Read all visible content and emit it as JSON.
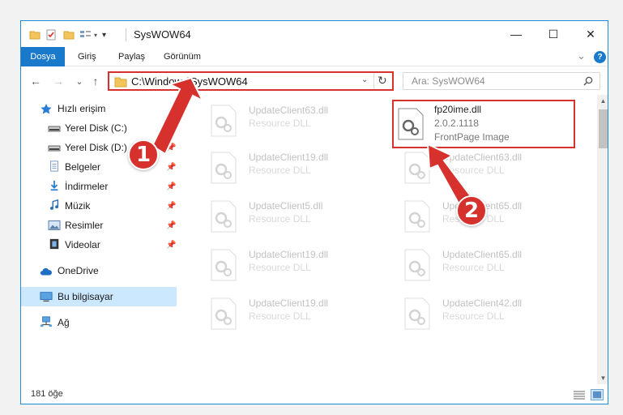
{
  "window": {
    "title": "SysWOW64",
    "minimize": "—",
    "maximize": "☐",
    "close": "✕"
  },
  "ribbon": {
    "tabs": [
      "Dosya",
      "Giriş",
      "Paylaş",
      "Görünüm"
    ],
    "collapse": "⌄",
    "help": "?"
  },
  "nav": {
    "back": "←",
    "forward": "→",
    "recent": "⌄",
    "up": "↑",
    "address": "C:\\Windows\\SysWOW64",
    "refresh": "↻",
    "search_placeholder": "Ara: SysWOW64",
    "search_icon": "search-icon"
  },
  "sidebar": {
    "quick_access": "Hızlı erişim",
    "items": [
      {
        "label": "Yerel Disk (C:)",
        "icon": "drive-icon"
      },
      {
        "label": "Yerel Disk (D:)",
        "icon": "drive-icon"
      },
      {
        "label": "Belgeler",
        "icon": "documents-icon"
      },
      {
        "label": "İndirmeler",
        "icon": "downloads-icon"
      },
      {
        "label": "Müzik",
        "icon": "music-icon"
      },
      {
        "label": "Resimler",
        "icon": "pictures-icon"
      },
      {
        "label": "Videolar",
        "icon": "videos-icon"
      }
    ],
    "onedrive": "OneDrive",
    "this_pc": "Bu bilgisayar",
    "network": "Ağ",
    "pin": "📌"
  },
  "files": {
    "left_column": [
      {
        "name": "UpdateClient63.dll",
        "desc": "Resource DLL"
      },
      {
        "name": "UpdateClient19.dll",
        "desc": "Resource DLL"
      },
      {
        "name": "UpdateClient5.dll",
        "desc": "Resource DLL"
      },
      {
        "name": "UpdateClient19.dll",
        "desc": "Resource DLL"
      },
      {
        "name": "UpdateClient19.dll",
        "desc": "Resource DLL"
      }
    ],
    "right_column": [
      {
        "name": "fp20ime.dll",
        "desc": "2.0.2.1118",
        "extra": "FrontPage Image"
      },
      {
        "name": "UpdateClient63.dll",
        "desc": "Resource DLL"
      },
      {
        "name": "UpdateClient65.dll",
        "desc": "Resource DLL"
      },
      {
        "name": "UpdateClient65.dll",
        "desc": "Resource DLL"
      },
      {
        "name": "UpdateClient42.dll",
        "desc": "Resource DLL"
      }
    ]
  },
  "status": {
    "count": "181 öğe"
  },
  "callouts": [
    "1",
    "2"
  ],
  "colors": {
    "accent": "#1979ca",
    "highlight": "#d6312c",
    "selected": "#cce8ff"
  }
}
